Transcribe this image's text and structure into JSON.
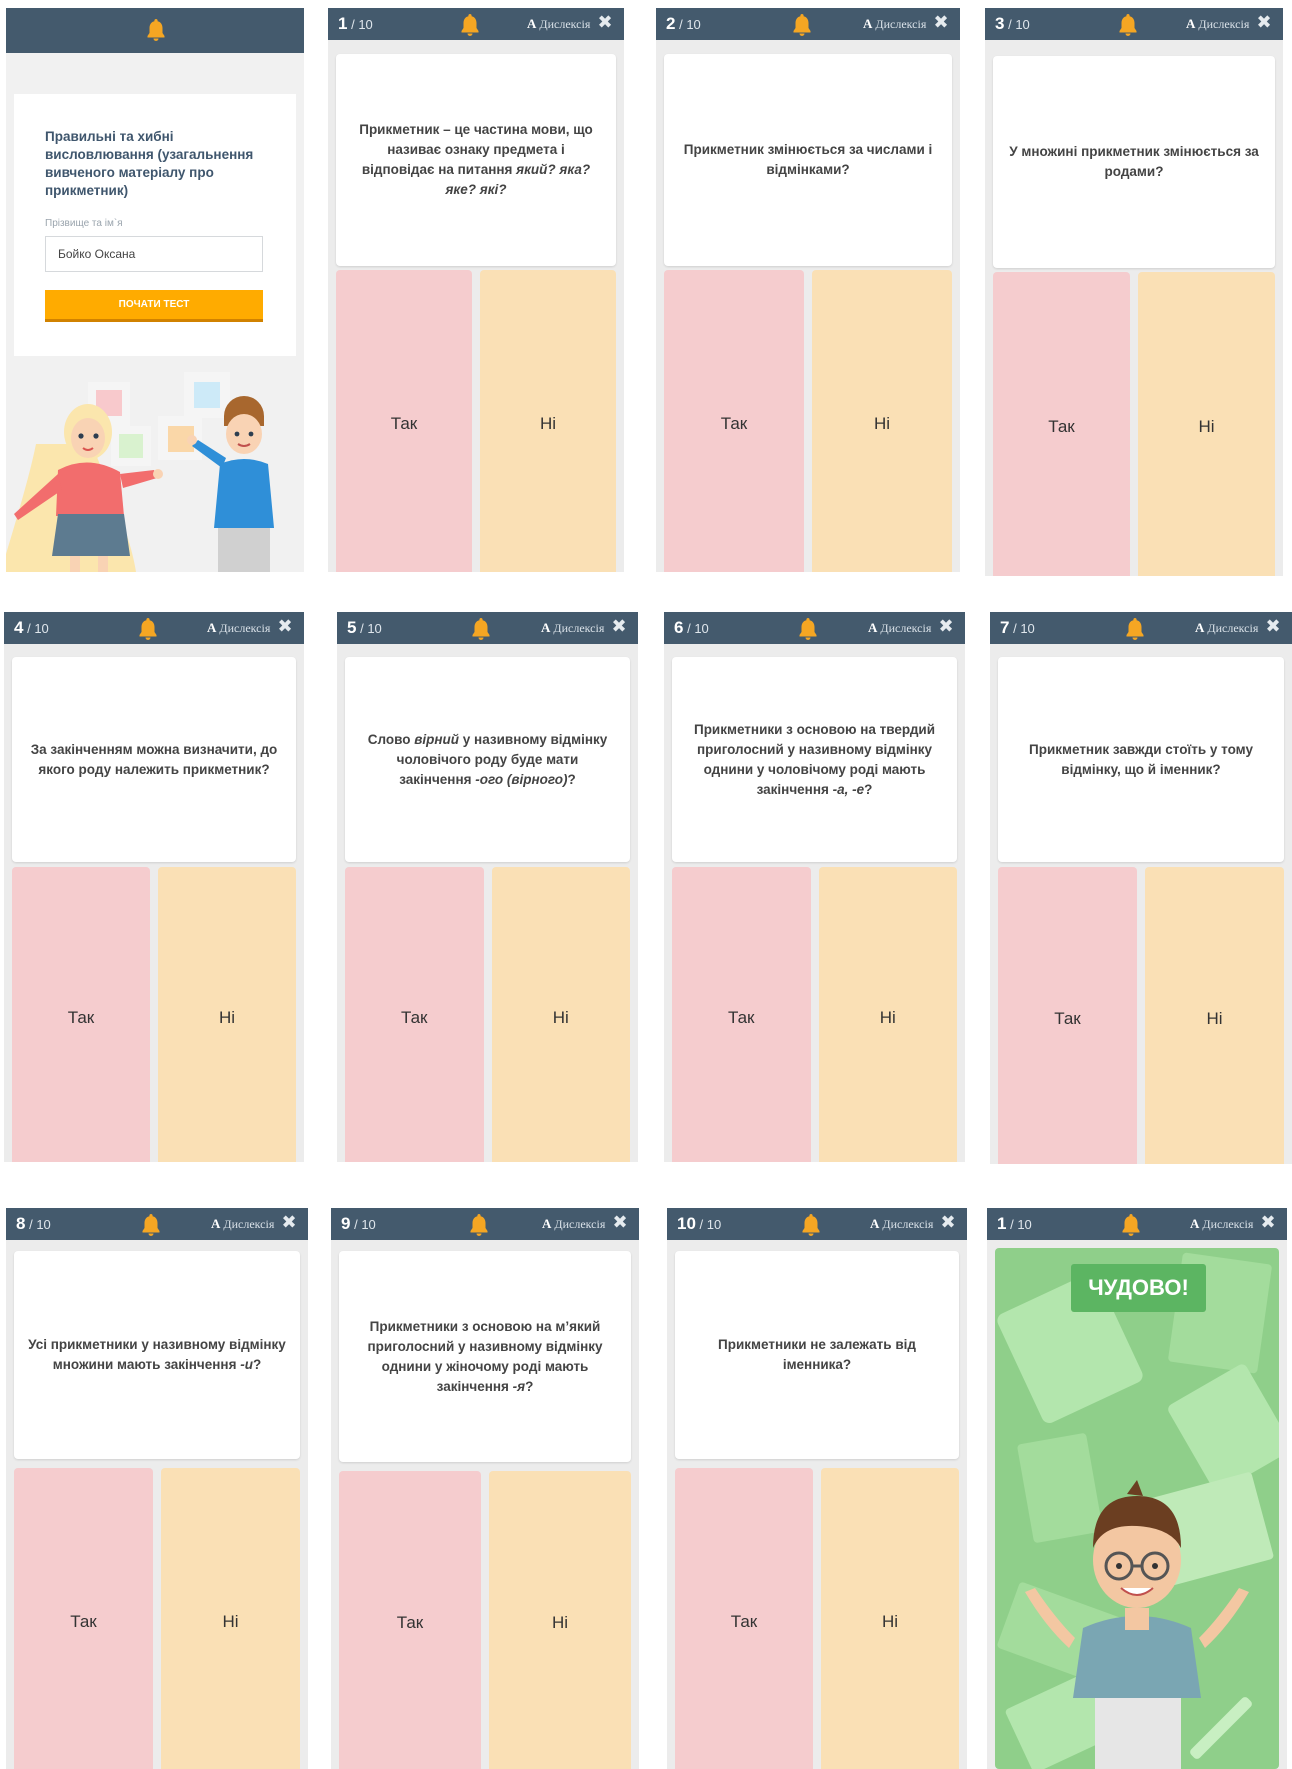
{
  "colors": {
    "topbar": "#445a6d",
    "yes": "#f5ccce",
    "no": "#fae0b5",
    "accent_button": "#ffab00",
    "success": "#5cb562"
  },
  "icons": {
    "bell": "bell-icon",
    "close": "close-icon"
  },
  "start": {
    "title": "Правильні та хибні висловлювання (узагальнення вивченого матеріалу про прикметник)",
    "name_label": "Прізвище та ім`я",
    "name_value": "Бойко Оксана",
    "start_button": "ПОЧАТИ ТЕСТ"
  },
  "common": {
    "total": "/ 10",
    "dyslexia_a": "A",
    "dyslexia_label": "Дислексія",
    "yes": "Так",
    "no": "Ні"
  },
  "questions": [
    {
      "num": "1",
      "text": "Прикметник – це частина мови, що називає ознаку предмета і відповідає на питання <i>який? яка? яке? які?</i>"
    },
    {
      "num": "2",
      "text": "Прикметник змінюється за числами і відмінками?"
    },
    {
      "num": "3",
      "text": "У множині прикметник змінюється за родами?"
    },
    {
      "num": "4",
      "text": "За закінченням можна визначити, до якого роду належить прикметник?"
    },
    {
      "num": "5",
      "text": "Слово <i>вірний</i> у називному відмінку чоловічого роду буде мати закінчення <i>-ого (вірного)</i>?"
    },
    {
      "num": "6",
      "text": "Прикметники з основою на твердий приголосний у називному відмінку однини у чоловічому роді мають закінчення <i>-а, -е</i>?"
    },
    {
      "num": "7",
      "text": "Прикметник завжди стоїть у тому відмінку, що й іменник?"
    },
    {
      "num": "8",
      "text": "Усі прикметники у називному відмінку множини мають закінчення <i>-и</i>?"
    },
    {
      "num": "9",
      "text": "Прикметники з основою на м’який приголосний у називному відмінку однини у жіночому роді мають закінчення <i>-я</i>?"
    },
    {
      "num": "10",
      "text": "Прикметники не залежать від іменника?"
    }
  ],
  "result": {
    "num": "1",
    "message": "ЧУДОВО!"
  }
}
